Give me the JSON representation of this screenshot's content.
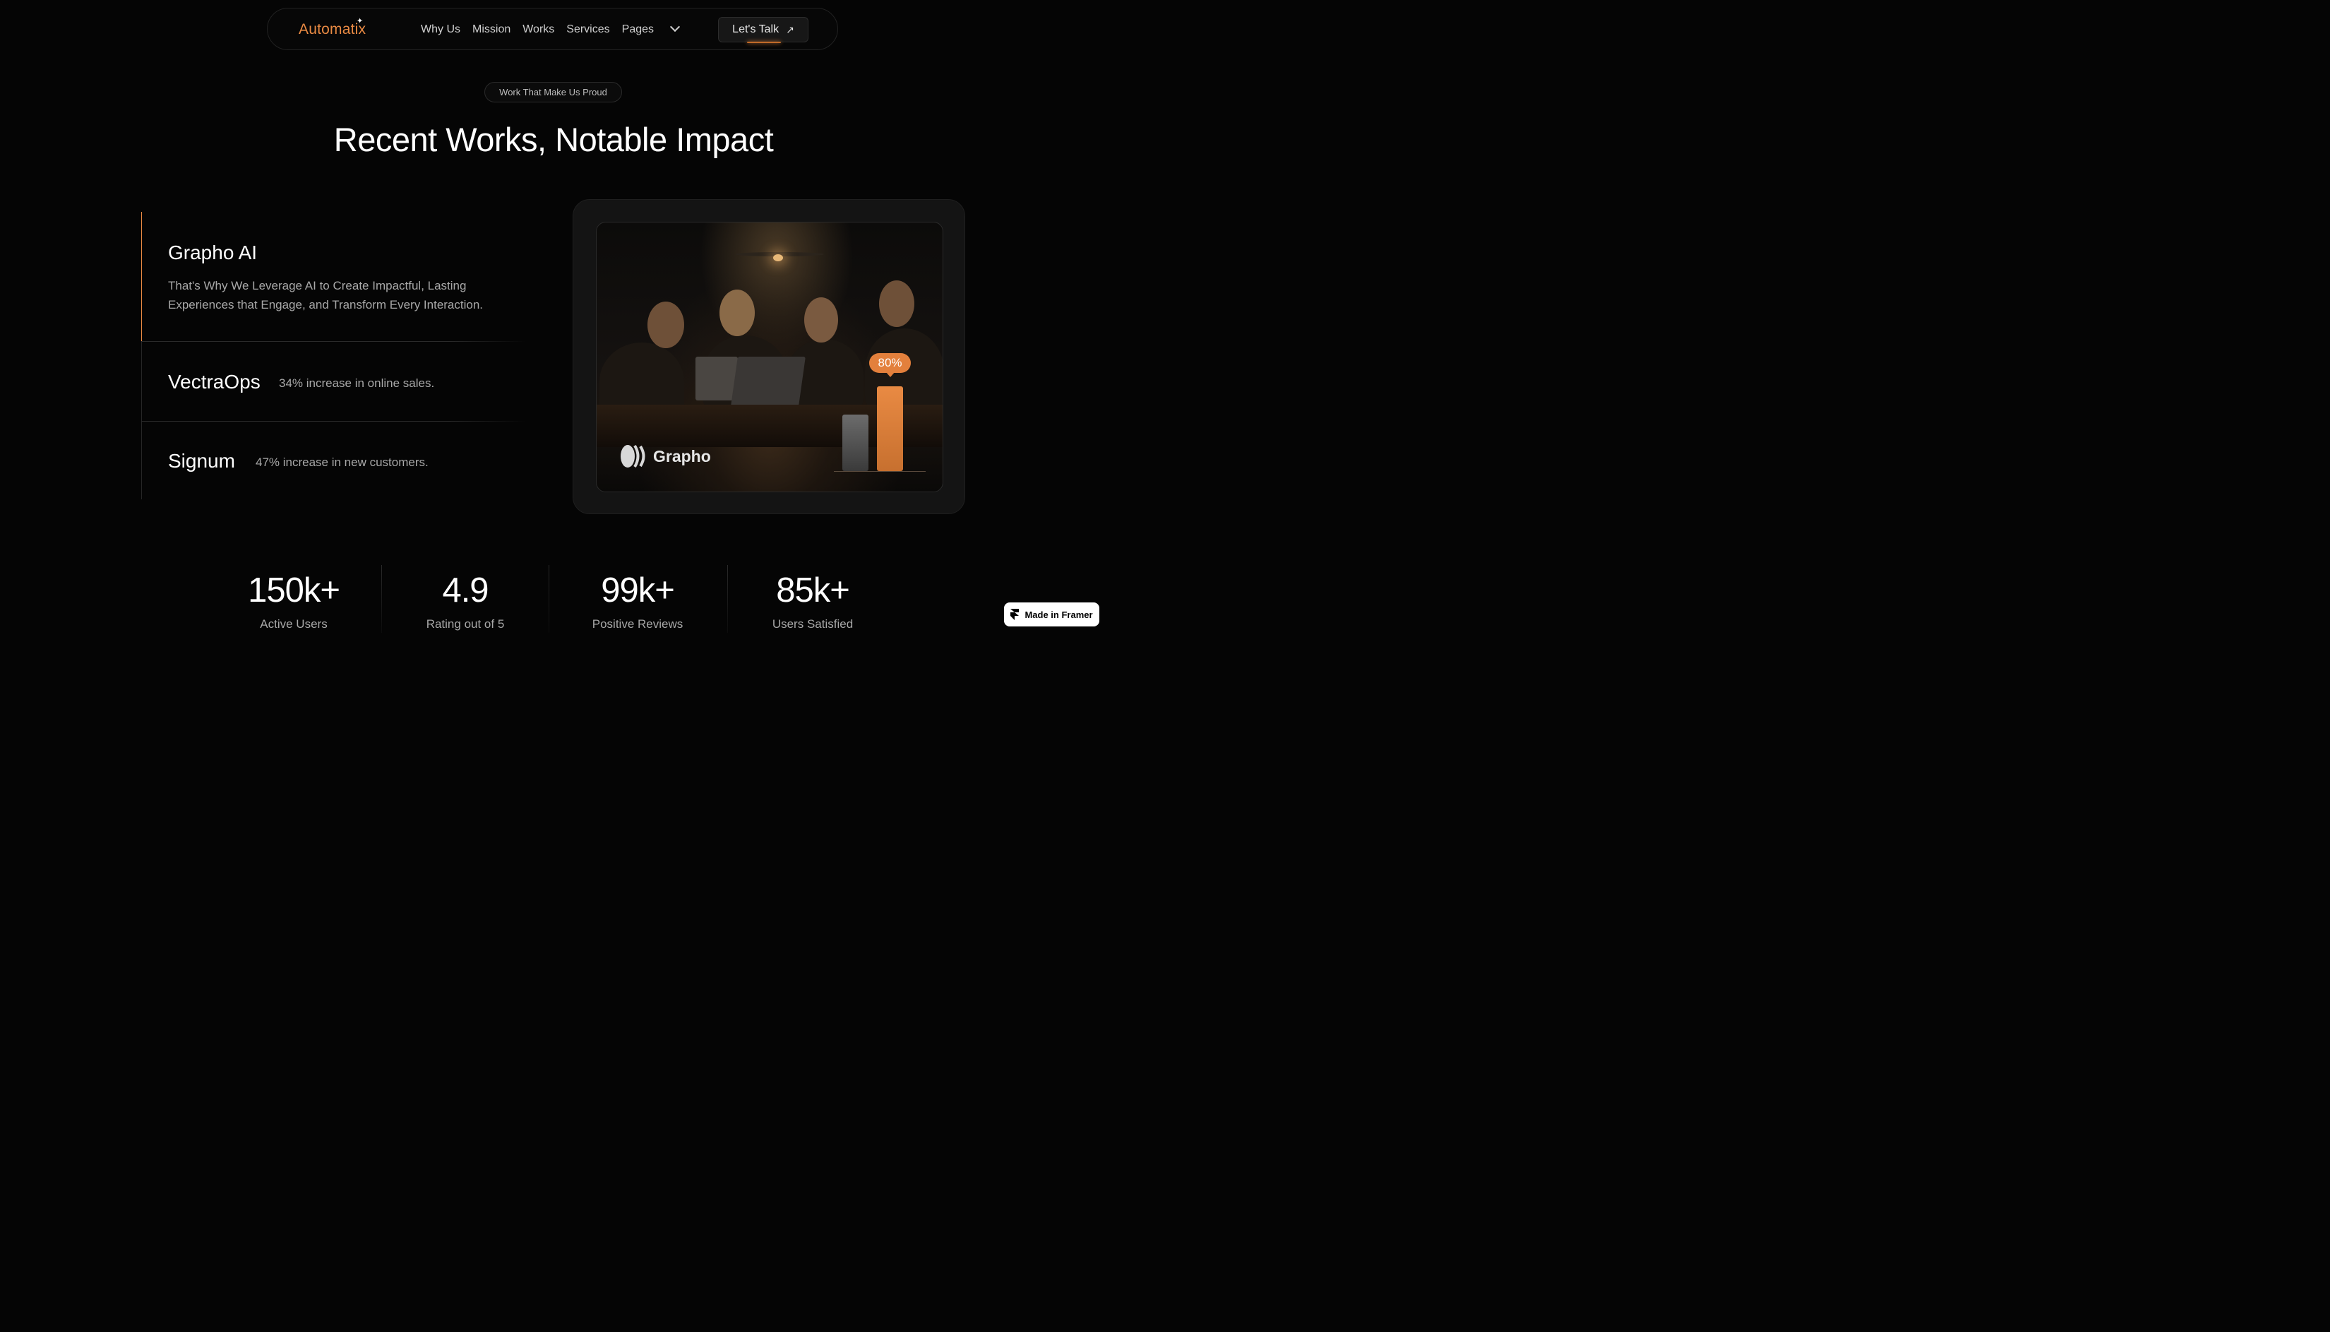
{
  "nav": {
    "logo": "Automatix",
    "links": [
      "Why Us",
      "Mission",
      "Works",
      "Services",
      "Pages"
    ],
    "cta": "Let's Talk"
  },
  "section": {
    "pill": "Work That Make Us Proud",
    "heading": "Recent Works, Notable Impact"
  },
  "works": [
    {
      "title": "Grapho AI",
      "desc": "That's Why We Leverage AI to Create Impactful, Lasting Experiences that Engage, and Transform Every Interaction."
    },
    {
      "title": "VectraOps",
      "stat": "34% increase in online sales."
    },
    {
      "title": "Signum",
      "stat": "47% increase in new customers."
    }
  ],
  "showcase": {
    "badge": "80%",
    "brand": "Grapho",
    "bar_value_fraction": 0.8,
    "accent": "#e98a43"
  },
  "stats": [
    {
      "value": "150k+",
      "label": "Active Users"
    },
    {
      "value": "4.9",
      "label": "Rating out of 5"
    },
    {
      "value": "99k+",
      "label": "Positive Reviews"
    },
    {
      "value": "85k+",
      "label": "Users Satisfied"
    }
  ],
  "framer_badge": "Made in Framer"
}
